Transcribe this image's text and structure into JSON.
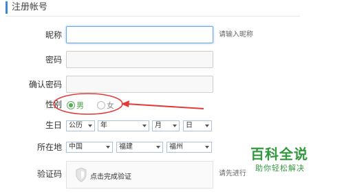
{
  "section": {
    "title": "注册帐号"
  },
  "form": {
    "nickname": {
      "label": "昵称",
      "value": "",
      "hint": "请输入昵称"
    },
    "password": {
      "label": "密码",
      "value": ""
    },
    "confirm_password": {
      "label": "确认密码",
      "value": ""
    },
    "gender": {
      "label": "性别",
      "male": "男",
      "female": "女",
      "selected": "男"
    },
    "birthday": {
      "label": "生日",
      "calendar": "公历",
      "year": "年",
      "month": "月",
      "day": "日"
    },
    "location": {
      "label": "所在地",
      "country": "中国",
      "province": "福建",
      "city": "福州"
    },
    "captcha": {
      "label": "验证码",
      "action": "点击完成验证",
      "hint": "请先进行"
    }
  },
  "watermark": {
    "main": "百科全说",
    "sub": "助你轻松解决"
  },
  "colors": {
    "accent": "#3a87d8",
    "annotation": "#e23b3b",
    "brand": "#2f9a3c",
    "radio": "#4caf50"
  }
}
